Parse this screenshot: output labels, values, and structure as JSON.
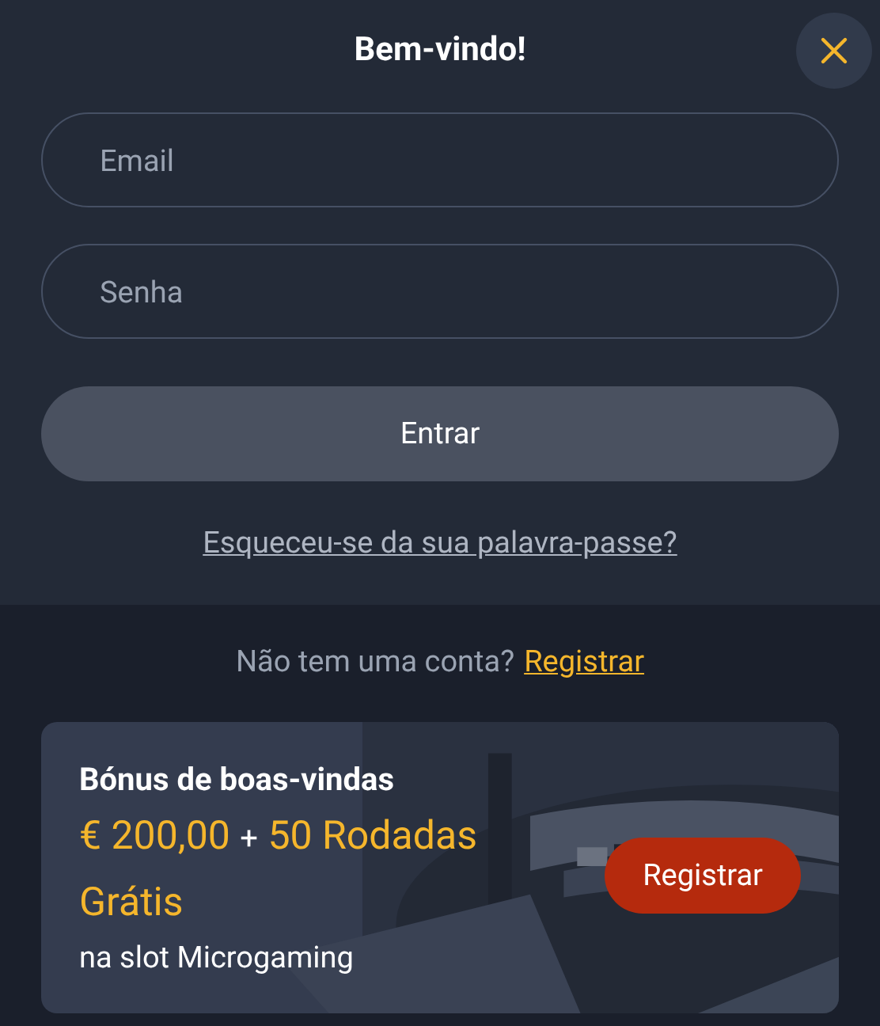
{
  "title": "Bem-vindo!",
  "fields": [
    {
      "placeholder": "Email"
    },
    {
      "placeholder": "Senha"
    }
  ],
  "submit": "Entrar",
  "forgot_link": "Esqueceu-se da sua palavra-passe?",
  "signup": {
    "prompt": "Não tem uma conta?",
    "link": "Registrar"
  },
  "bonus": {
    "title": "Bónus de boas-vindas",
    "amount": "€ 200,00",
    "separator": "+",
    "spins": "50 Rodadas Grátis",
    "subtitle": "na slot Microgaming",
    "button": "Registrar"
  }
}
